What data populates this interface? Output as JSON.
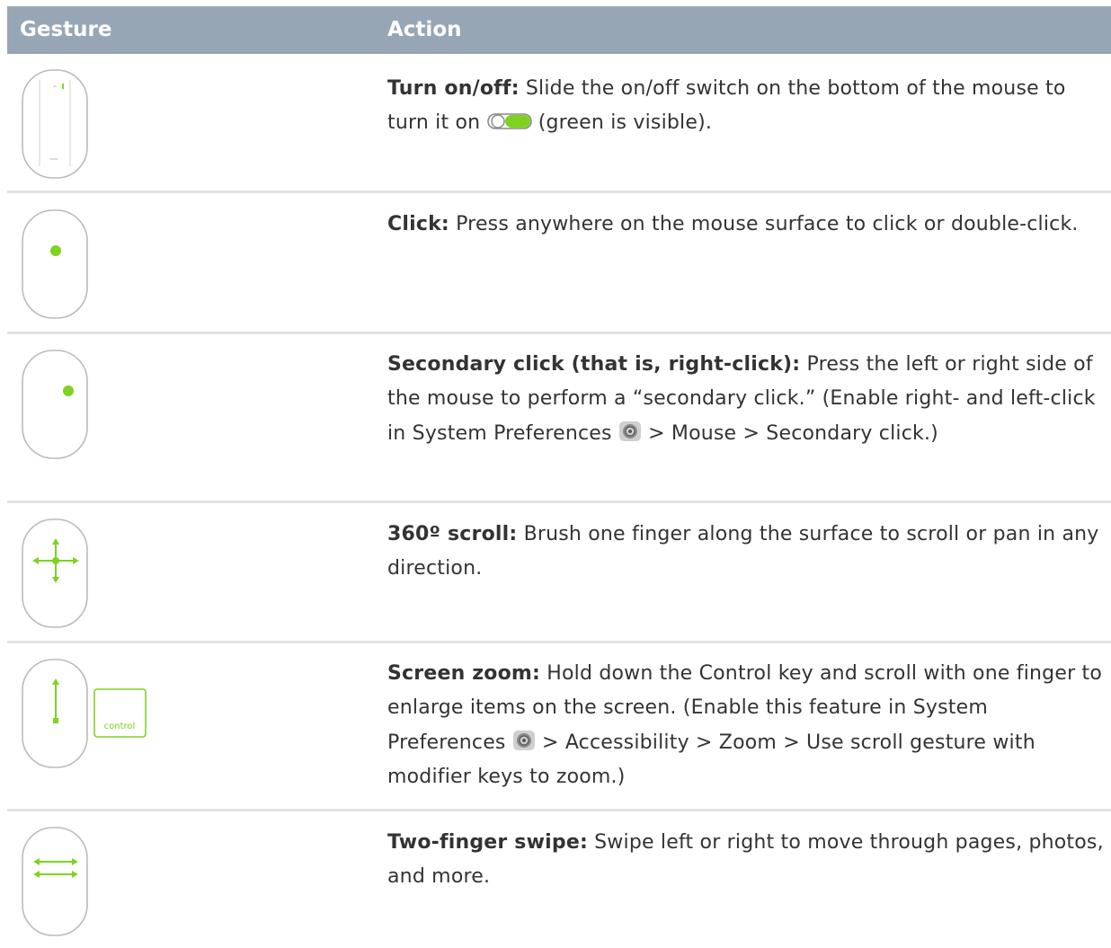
{
  "table": {
    "headers": {
      "gesture": "Gesture",
      "action": "Action"
    },
    "rows": [
      {
        "icon": "mouse-power-switch-icon",
        "title": "Turn on/off:",
        "text_before": " Slide the on/off switch on the bottom of the mouse to turn it on ",
        "inline_icon": "toggle-switch-icon",
        "text_after": " (green is visible)."
      },
      {
        "icon": "mouse-click-icon",
        "title": "Click:",
        "text": " Press anywhere on the mouse surface to click or double-click."
      },
      {
        "icon": "mouse-secondary-click-icon",
        "title": "Secondary click (that is, right-click):",
        "text_before": " Press the left or right side of the mouse to perform a “secondary click.” (Enable right- and left-click in System Preferences ",
        "inline_icon": "system-preferences-icon",
        "text_after": " > Mouse > Secondary click.)"
      },
      {
        "icon": "mouse-scroll-icon",
        "title": "360º scroll:",
        "text": " Brush one finger along the surface to scroll or pan in any direction."
      },
      {
        "icon": "mouse-zoom-icon",
        "key_label": "control",
        "title": "Screen zoom:",
        "text_before": " Hold down the Control key and scroll with one finger to enlarge items on the screen. (Enable this feature in System Preferences ",
        "inline_icon": "system-preferences-icon",
        "text_after": " > Accessibility > Zoom > Use scroll gesture with modifier keys to zoom.)"
      },
      {
        "icon": "mouse-swipe-icon",
        "title": "Two-finger swipe:",
        "text": " Swipe left or right to move through pages, photos, and more."
      }
    ]
  },
  "colors": {
    "header_bg": "#97a6b5",
    "accent_green": "#7ed321",
    "divider": "#e2e2e2"
  }
}
